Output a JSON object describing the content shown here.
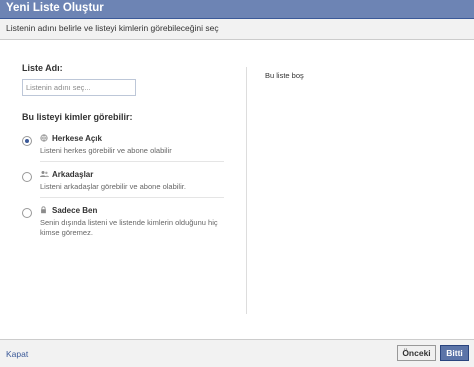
{
  "dialog": {
    "title": "Yeni Liste Oluştur",
    "subtitle": "Listenin adını belirle ve listeyi kimlerin görebileceğini seç"
  },
  "form": {
    "name_label": "Liste Adı:",
    "name_placeholder": "Listenin adını seç...",
    "name_value": "",
    "visibility_heading": "Bu listeyi kimler görebilir:",
    "options": [
      {
        "icon": "globe-icon",
        "title": "Herkese Açık",
        "description": "Listeni herkes görebilir ve abone olabilir",
        "selected": true
      },
      {
        "icon": "friends-icon",
        "title": "Arkadaşlar",
        "description": "Listeni arkadaşlar görebilir ve abone olabilir.",
        "selected": false
      },
      {
        "icon": "lock-icon",
        "title": "Sadece Ben",
        "description": "Senin dışında listeni ve listende kimlerin olduğunu hiç kimse göremez.",
        "selected": false
      }
    ]
  },
  "preview": {
    "empty_text": "Bu liste boş"
  },
  "footer": {
    "close_label": "Kapat",
    "prev_label": "Önceki",
    "done_label": "Bitti"
  },
  "colors": {
    "title_bar": "#6d84b4",
    "link": "#3b5998",
    "primary_button": "#5b74a8"
  }
}
